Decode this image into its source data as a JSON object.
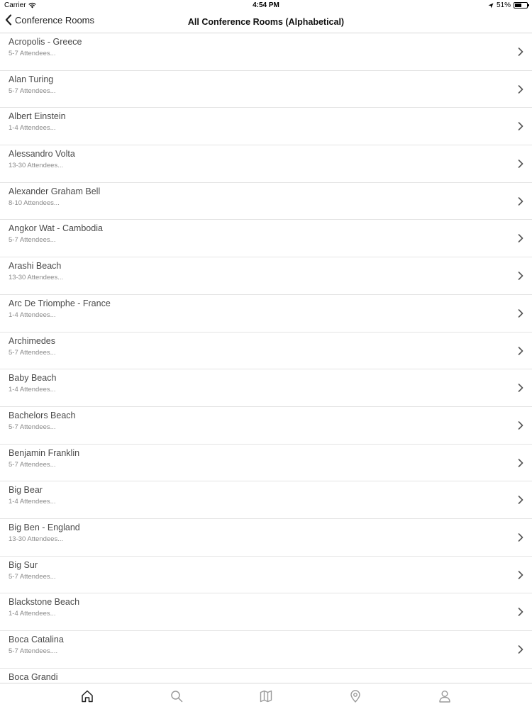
{
  "status": {
    "carrier": "Carrier",
    "time": "4:54 PM",
    "battery": "51%",
    "battery_level": 0.51
  },
  "nav": {
    "back_label": "Conference Rooms",
    "title": "All Conference Rooms (Alphabetical)"
  },
  "rooms": [
    {
      "name": "Acropolis - Greece",
      "capacity": "5-7 Attendees..."
    },
    {
      "name": "Alan Turing",
      "capacity": "5-7 Attendees..."
    },
    {
      "name": "Albert Einstein",
      "capacity": "1-4 Attendees..."
    },
    {
      "name": "Alessandro Volta",
      "capacity": "13-30 Attendees..."
    },
    {
      "name": "Alexander Graham Bell",
      "capacity": "8-10 Attendees..."
    },
    {
      "name": "Angkor Wat - Cambodia",
      "capacity": "5-7 Attendees..."
    },
    {
      "name": "Arashi Beach",
      "capacity": "13-30 Attendees..."
    },
    {
      "name": "Arc De Triomphe - France",
      "capacity": "1-4 Attendees..."
    },
    {
      "name": "Archimedes",
      "capacity": "5-7 Attendees..."
    },
    {
      "name": "Baby Beach",
      "capacity": "1-4 Attendees..."
    },
    {
      "name": "Bachelors Beach",
      "capacity": "5-7 Attendees..."
    },
    {
      "name": "Benjamin Franklin",
      "capacity": "5-7 Attendees..."
    },
    {
      "name": "Big Bear",
      "capacity": "1-4 Attendees..."
    },
    {
      "name": "Big Ben - England",
      "capacity": "13-30 Attendees..."
    },
    {
      "name": "Big Sur",
      "capacity": "5-7 Attendees..."
    },
    {
      "name": "Blackstone Beach",
      "capacity": "1-4 Attendees..."
    },
    {
      "name": "Boca Catalina",
      "capacity": "5-7 Attendees...."
    },
    {
      "name": "Boca Grandi",
      "capacity": ""
    }
  ],
  "tabs": [
    {
      "icon": "home-icon",
      "active": true
    },
    {
      "icon": "search-icon",
      "active": false
    },
    {
      "icon": "map-icon",
      "active": false
    },
    {
      "icon": "location-pin-icon",
      "active": false
    },
    {
      "icon": "profile-icon",
      "active": false
    }
  ],
  "colors": {
    "text": "#4a4a4a",
    "subtext": "#8a8a8a",
    "divider": "#e4e4e4",
    "active_tab": "#222222",
    "inactive_tab": "#9a9a9a"
  }
}
